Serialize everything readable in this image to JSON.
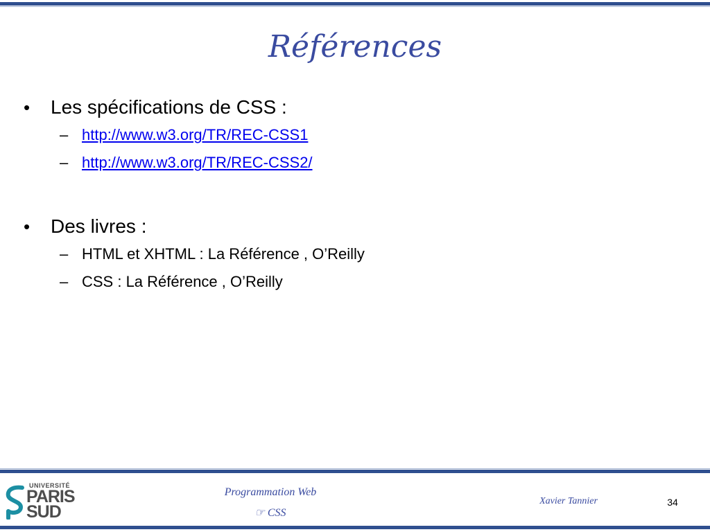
{
  "slide": {
    "title": "Références",
    "sections": [
      {
        "bullet": "Les spécifications de CSS :",
        "items": [
          {
            "text": "http://www.w3.org/TR/REC-CSS1"
          },
          {
            "text": "http://www.w3.org/TR/REC-CSS2/"
          }
        ]
      },
      {
        "bullet": "Des livres :",
        "items": [
          {
            "text": "HTML et XHTML : La Référence , O’Reilly"
          },
          {
            "text": "CSS : La Référence , O’Reilly"
          }
        ]
      }
    ],
    "bullet_symbol": "•",
    "dash_symbol": "–"
  },
  "footer": {
    "logo": {
      "line1": "UNIVERSITÉ",
      "line2": "PARIS",
      "line3": "SUD",
      "icon": "paris-sud-s-icon"
    },
    "course": "Programmation Web",
    "topic_icon": "hand-pointing-icon",
    "topic_symbol": "☞",
    "topic": "CSS",
    "author": "Xavier Tannier",
    "page_number": "34"
  },
  "colors": {
    "accent": "#3a4ba0",
    "bar": "#2f4f8f",
    "link": "#0000ee",
    "logo_teal": "#1c8fa3"
  }
}
